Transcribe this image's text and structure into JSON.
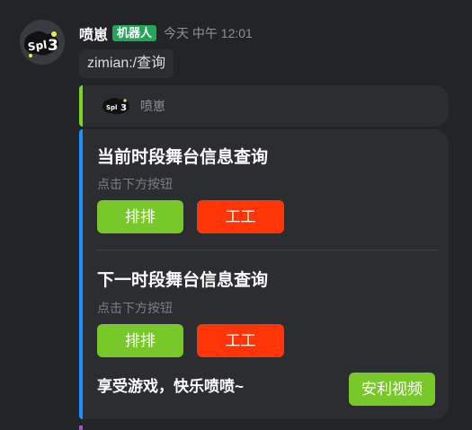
{
  "message": {
    "username": "喷崽",
    "badge": "机器人",
    "timestamp": "今天 中午 12:01",
    "avatar_icon": "splatoon3-logo-icon"
  },
  "command": {
    "text": "zimian:/查询"
  },
  "reply": {
    "name": "喷崽",
    "accent": "#7ed321"
  },
  "card": {
    "accent": "#1e90ff",
    "sections": [
      {
        "title": "当前时段舞台信息查询",
        "hint": "点击下方按钮",
        "buttons": [
          {
            "label": "排排",
            "color": "#78c82a"
          },
          {
            "label": "工工",
            "color": "#ff3508"
          }
        ]
      },
      {
        "title": "下一时段舞台信息查询",
        "hint": "点击下方按钮",
        "buttons": [
          {
            "label": "排排",
            "color": "#78c82a"
          },
          {
            "label": "工工",
            "color": "#ff3508"
          }
        ]
      }
    ],
    "footer_text": "享受游戏，快乐喷喷~",
    "video_button": "安利视频"
  }
}
